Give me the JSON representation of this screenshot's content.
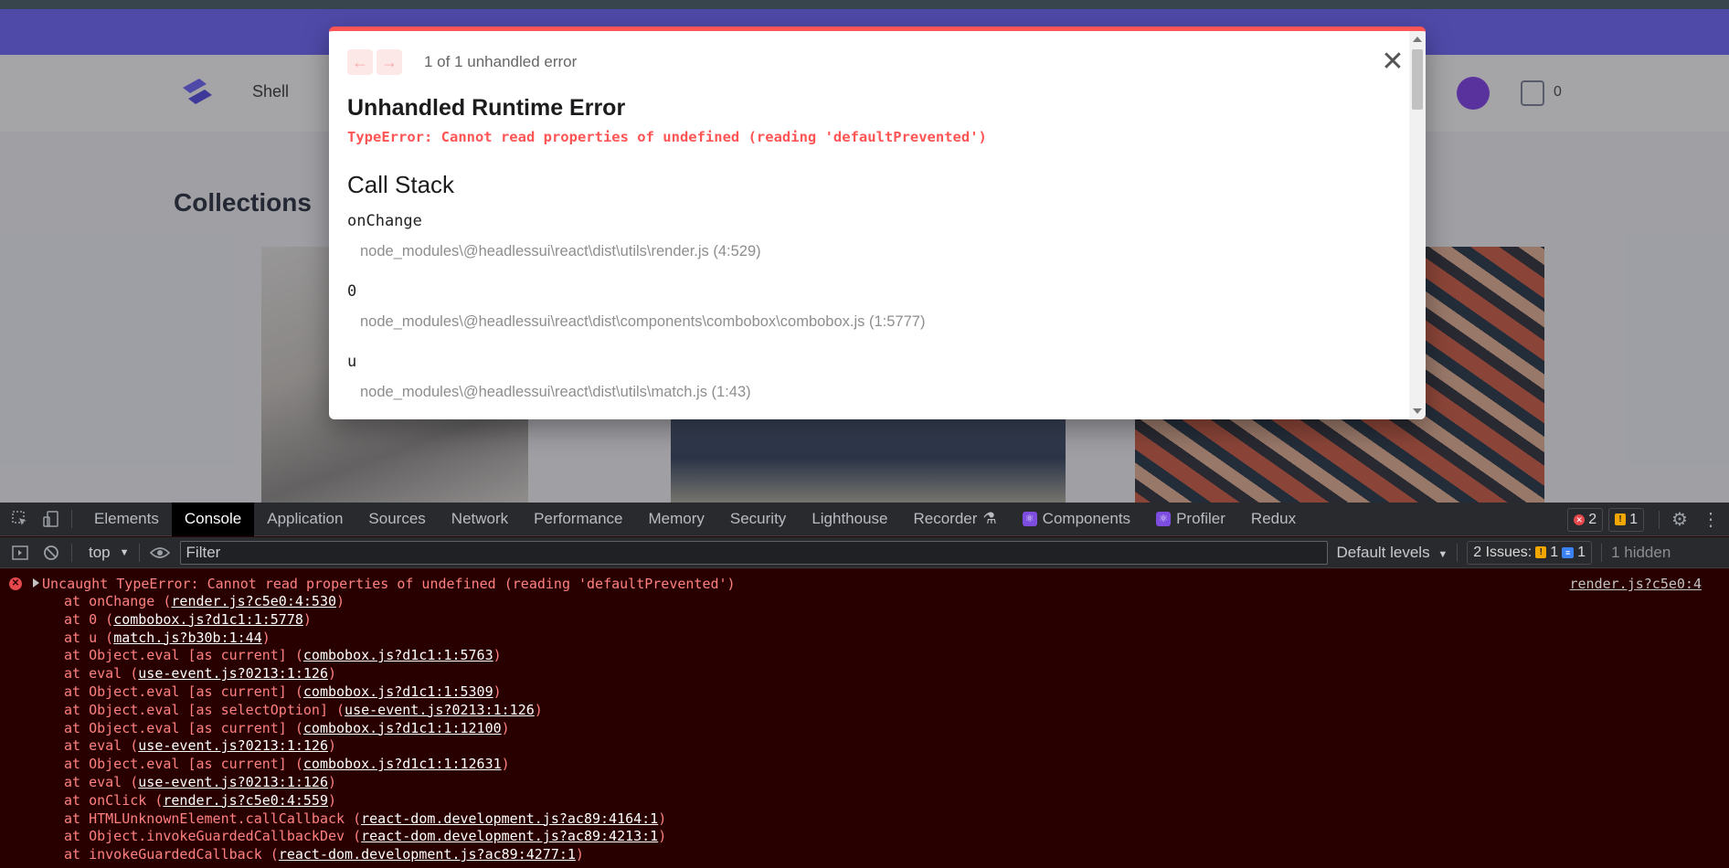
{
  "page": {
    "nav_link": "Shell",
    "section_title": "Collections",
    "bag_count": "0"
  },
  "overlay": {
    "prev_arrow": "←",
    "next_arrow": "→",
    "error_count": "1 of 1 unhandled error",
    "close_glyph": "✕",
    "title": "Unhandled Runtime Error",
    "message": "TypeError: Cannot read properties of undefined (reading 'defaultPrevented')",
    "call_stack_title": "Call Stack",
    "frames": [
      {
        "fn": "onChange",
        "file": "node_modules\\@headlessui\\react\\dist\\utils\\render.js (4:529)"
      },
      {
        "fn": "0",
        "file": "node_modules\\@headlessui\\react\\dist\\components\\combobox\\combobox.js (1:5777)"
      },
      {
        "fn": "u",
        "file": "node_modules\\@headlessui\\react\\dist\\utils\\match.js (1:43)"
      }
    ]
  },
  "devtools": {
    "tabs": [
      "Elements",
      "Console",
      "Application",
      "Sources",
      "Network",
      "Performance",
      "Memory",
      "Security",
      "Lighthouse",
      "Recorder",
      "Components",
      "Profiler",
      "Redux"
    ],
    "active_tab": "Console",
    "error_badge": "2",
    "warning_badge": "1",
    "context": "top",
    "filter_placeholder": "Filter",
    "levels": "Default levels",
    "issues_label": "2 Issues:",
    "issues_warn": "1",
    "issues_info": "1",
    "hidden": "1 hidden",
    "error_message": "Uncaught TypeError: Cannot read properties of undefined (reading 'defaultPrevented')",
    "error_source": "render.js?c5e0:4",
    "stack": [
      {
        "pre": "at onChange (",
        "link": "render.js?c5e0:4:530",
        "post": ")"
      },
      {
        "pre": "at 0 (",
        "link": "combobox.js?d1c1:1:5778",
        "post": ")"
      },
      {
        "pre": "at u (",
        "link": "match.js?b30b:1:44",
        "post": ")"
      },
      {
        "pre": "at Object.eval [as current] (",
        "link": "combobox.js?d1c1:1:5763",
        "post": ")"
      },
      {
        "pre": "at eval (",
        "link": "use-event.js?0213:1:126",
        "post": ")"
      },
      {
        "pre": "at Object.eval [as current] (",
        "link": "combobox.js?d1c1:1:5309",
        "post": ")"
      },
      {
        "pre": "at Object.eval [as selectOption] (",
        "link": "use-event.js?0213:1:126",
        "post": ")"
      },
      {
        "pre": "at Object.eval [as current] (",
        "link": "combobox.js?d1c1:1:12100",
        "post": ")"
      },
      {
        "pre": "at eval (",
        "link": "use-event.js?0213:1:126",
        "post": ")"
      },
      {
        "pre": "at Object.eval [as current] (",
        "link": "combobox.js?d1c1:1:12631",
        "post": ")"
      },
      {
        "pre": "at eval (",
        "link": "use-event.js?0213:1:126",
        "post": ")"
      },
      {
        "pre": "at onClick (",
        "link": "render.js?c5e0:4:559",
        "post": ")"
      },
      {
        "pre": "at HTMLUnknownElement.callCallback (",
        "link": "react-dom.development.js?ac89:4164:1",
        "post": ")"
      },
      {
        "pre": "at Object.invokeGuardedCallbackDev (",
        "link": "react-dom.development.js?ac89:4213:1",
        "post": ")"
      },
      {
        "pre": "at invokeGuardedCallback (",
        "link": "react-dom.development.js?ac89:4277:1",
        "post": ")"
      }
    ]
  }
}
